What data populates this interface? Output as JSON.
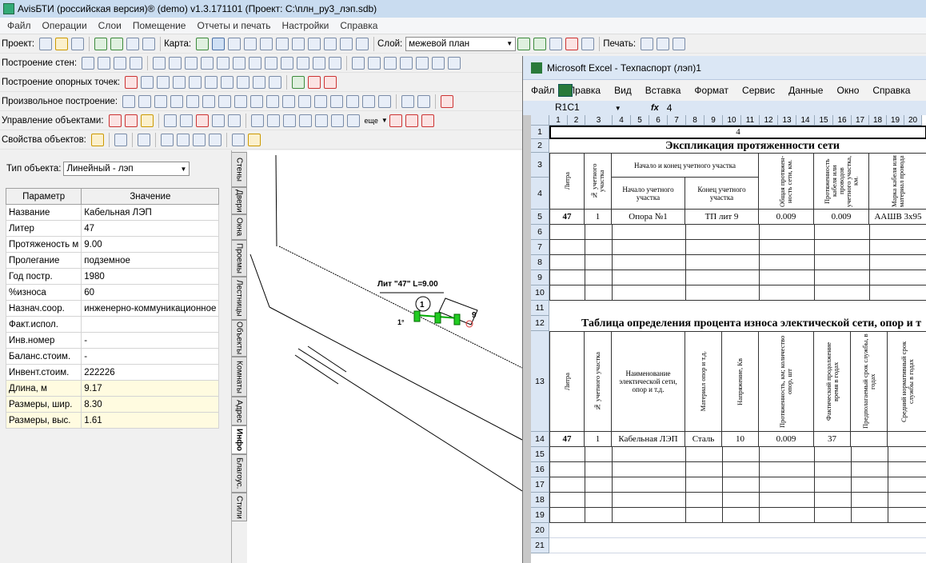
{
  "window": {
    "title": "AvisБТИ (российская версия)® (demo) v1.3.171101 (Проект: C:\\плн_ру3_лэп.sdb)"
  },
  "menu": [
    "Файл",
    "Операции",
    "Слои",
    "Помещение",
    "Отчеты и печать",
    "Настройки",
    "Справка"
  ],
  "toolbar": {
    "project_label": "Проект:",
    "map_label": "Карта:",
    "layer_label": "Слой:",
    "layer_value": "межевой план",
    "print_label": "Печать:",
    "more_label": "еще"
  },
  "toolbar_rows": {
    "walls": "Построение стен:",
    "ref_points": "Построение опорных точек:",
    "free": "Произвольное построение:",
    "objects": "Управление объектами:",
    "props": "Свойства объектов:"
  },
  "object_type": {
    "label": "Тип объекта:",
    "value": "Линейный - лэп"
  },
  "props_table": {
    "header": {
      "param": "Параметр",
      "value": "Значение"
    },
    "rows": [
      {
        "k": "Название",
        "v": "Кабельная ЛЭП"
      },
      {
        "k": "Литер",
        "v": "47"
      },
      {
        "k": "Протяженость м",
        "v": "9.00"
      },
      {
        "k": "Пролегание",
        "v": "подземное"
      },
      {
        "k": "Год постр.",
        "v": "1980"
      },
      {
        "k": "%износа",
        "v": "60"
      },
      {
        "k": "Назнач.соор.",
        "v": "инженерно-коммуникационное"
      },
      {
        "k": "Факт.испол.",
        "v": ""
      },
      {
        "k": "Инв.номер",
        "v": "-"
      },
      {
        "k": "Баланс.стоим.",
        "v": "-"
      },
      {
        "k": "Инвент.стоим.",
        "v": "222226"
      },
      {
        "k": "Длина, м",
        "v": "9.17"
      },
      {
        "k": "Размеры, шир.",
        "v": "8.30"
      },
      {
        "k": "Размеры, выс.",
        "v": "1.61"
      }
    ]
  },
  "side_tabs": [
    "Стены",
    "Двери",
    "Окна",
    "Проемы",
    "Лестницы",
    "Объекты",
    "Комнаты",
    "Адрес",
    "Инфо",
    "Благоус.",
    "Стили"
  ],
  "drawing": {
    "label_line": "Лит \"47\" L=9.00",
    "marker1": "1",
    "deg": "1°",
    "marker9": "9"
  },
  "excel": {
    "title": "Microsoft Excel - Техпаспорт (лэп)1",
    "menu": [
      "Файл",
      "Правка",
      "Вид",
      "Вставка",
      "Формат",
      "Сервис",
      "Данные",
      "Окно",
      "Справка"
    ],
    "namebox": "R1C1",
    "fx": "fx",
    "formula": "4",
    "columns": [
      "1",
      "2",
      "3",
      "4",
      "5",
      "6",
      "7",
      "8",
      "9",
      "10",
      "11",
      "12",
      "13",
      "14",
      "15",
      "16",
      "17",
      "18",
      "19",
      "20"
    ],
    "rows": [
      "1",
      "2",
      "3",
      "4",
      "5",
      "6",
      "7",
      "8",
      "9",
      "10",
      "11",
      "12",
      "13",
      "14",
      "15",
      "16",
      "17",
      "18",
      "19",
      "20",
      "21"
    ],
    "r1": "4",
    "title1": "Экспликация протяженности сети",
    "t1_headers": {
      "litera": "Литра",
      "num": "№ учетного участка",
      "start_end": "Начало и конец учетного участка",
      "start": "Начало учетного участка",
      "end": "Конец учетного участка",
      "total": "Общая протяжен-ность сети, км.",
      "cable_len": "Протяженность кабеля или проводов учетного участка, км.",
      "brand": "Марка кабеля или материал провода"
    },
    "t1_row": {
      "litera": "47",
      "num": "1",
      "start": "Опора №1",
      "end": "ТП лит 9",
      "total": "0.009",
      "cable_len": "0.009",
      "brand": "ААШВ 3х95"
    },
    "title2": "Таблица определения процента износа электической сети, опор и т",
    "t2_headers": {
      "litera": "Литра",
      "num": "№ учетного участка",
      "name": "Наименование электической сети, опор и т.д.",
      "material": "Материал опор и т.д.",
      "voltage": "Напряжение, Кв",
      "length": "Протяженность, км; количество опор, шт",
      "actual": "Фактический продолжение время в годах",
      "norm": "Предполагаемый срок службы, в годах",
      "avg": "Средний нормативный срок службы в годах"
    },
    "t2_row": {
      "litera": "47",
      "num": "1",
      "name": "Кабельная ЛЭП",
      "material": "Сталь",
      "voltage": "10",
      "length": "0.009",
      "actual": "37"
    }
  }
}
